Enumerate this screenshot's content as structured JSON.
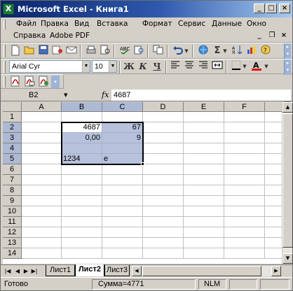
{
  "window": {
    "title": "Microsoft Excel - Книга1",
    "app_icon_letter": "X"
  },
  "caption_buttons": {
    "minimize": "_",
    "maximize": "□",
    "close": "×"
  },
  "menu": {
    "row1": [
      "Файл",
      "Правка",
      "Вид",
      "Вставка",
      "Формат",
      "Сервис",
      "Данные",
      "Окно"
    ],
    "row2": [
      "Справка",
      "Adobe PDF"
    ],
    "doc_buttons": {
      "minimize": "_",
      "restore": "❐",
      "close": "×"
    }
  },
  "formatting": {
    "font_name": "Arial Cyr",
    "font_size": "10",
    "bold": "Ж",
    "italic": "К",
    "underline": "Ч"
  },
  "standard_toolbar": {
    "sigma": "Σ",
    "fx_label": "fx"
  },
  "formula_bar": {
    "name_box": "B2",
    "fx": "fx",
    "formula": "4687"
  },
  "columns": [
    "A",
    "B",
    "C",
    "D",
    "E",
    "F"
  ],
  "rows": [
    "1",
    "2",
    "3",
    "4",
    "5",
    "6",
    "7",
    "8",
    "9",
    "10",
    "11",
    "12",
    "13",
    "14"
  ],
  "cells": {
    "B2": "4687",
    "C2": "67",
    "B3": "0,00",
    "C3": "9",
    "B5": "1234",
    "C5": "e"
  },
  "sheets": [
    "Лист1",
    "Лист2",
    "Лист3"
  ],
  "active_sheet": "Лист2",
  "status": {
    "ready": "Готово",
    "sum": "Сумма=4771",
    "numlock": "NLM"
  },
  "colors": {
    "title_start": "#0a246a",
    "title_end": "#a6caf0",
    "selection": "#b7c2dc",
    "selected_header": "#aeb9d4",
    "chrome": "#d4d0c8"
  }
}
